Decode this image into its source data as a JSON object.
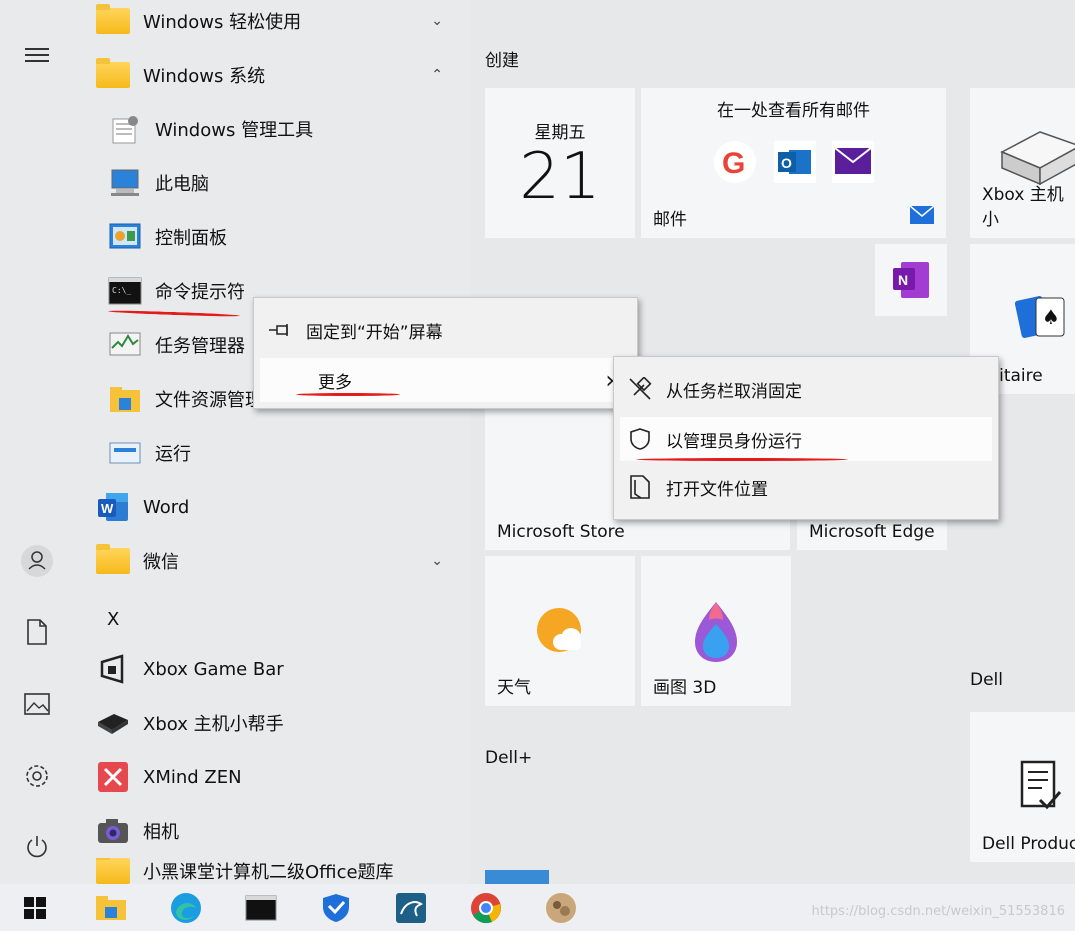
{
  "rail_icons": [
    "menu-icon",
    "user-icon",
    "document-icon",
    "pictures-icon",
    "settings-icon",
    "power-icon"
  ],
  "app_list": {
    "items": [
      {
        "label": "Windows 轻松使用",
        "icon": "folder-icon",
        "chevron": "⌄"
      },
      {
        "label": "Windows 系统",
        "icon": "folder-icon",
        "chevron": "⌃"
      },
      {
        "label": "Windows 管理工具",
        "icon": "admin-tools-icon"
      },
      {
        "label": "此电脑",
        "icon": "this-pc-icon"
      },
      {
        "label": "控制面板",
        "icon": "control-panel-icon"
      },
      {
        "label": "命令提示符",
        "icon": "cmd-icon"
      },
      {
        "label": "任务管理器",
        "icon": "task-manager-icon"
      },
      {
        "label": "文件资源管理器",
        "icon": "file-explorer-icon"
      },
      {
        "label": "运行",
        "icon": "run-icon"
      },
      {
        "label": "Word",
        "icon": "word-icon"
      },
      {
        "label": "微信",
        "icon": "folder-icon",
        "chevron": "⌄"
      },
      {
        "label": "X",
        "icon": "section-letter"
      },
      {
        "label": "Xbox Game Bar",
        "icon": "xbox-game-bar-icon"
      },
      {
        "label": "Xbox 主机小帮手",
        "icon": "xbox-console-icon"
      },
      {
        "label": "XMind ZEN",
        "icon": "xmind-icon"
      },
      {
        "label": "相机",
        "icon": "camera-icon"
      },
      {
        "label": "小黑课堂计算机二级Office题库",
        "icon": "folder-icon"
      }
    ]
  },
  "tiles": {
    "group_create": "创建",
    "calendar": {
      "day": "星期五",
      "date": "21"
    },
    "mail": {
      "title": "在一处查看所有邮件",
      "label": "邮件"
    },
    "xbox": {
      "label": "Xbox 主机小"
    },
    "solitaire": {
      "label": "olitaire"
    },
    "store": {
      "label": "Microsoft Store"
    },
    "edge": {
      "label": "Microsoft Edge"
    },
    "weather": {
      "label": "天气"
    },
    "paint3d": {
      "label": "画图 3D"
    },
    "group_dell": "Dell",
    "group_dellplus": "Dell+",
    "dell_product": {
      "label": "Dell Produc"
    }
  },
  "context_menu": {
    "items": [
      {
        "label": "固定到“开始”屏幕",
        "icon": "pin-icon"
      },
      {
        "label": "更多",
        "icon": "",
        "arrow": "›"
      }
    ]
  },
  "sub_menu": {
    "items": [
      {
        "label": "从任务栏取消固定",
        "icon": "unpin-icon"
      },
      {
        "label": "以管理员身份运行",
        "icon": "shield-icon"
      },
      {
        "label": "打开文件位置",
        "icon": "file-location-icon"
      }
    ]
  },
  "taskbar": [
    "windows-start-icon",
    "file-explorer-icon",
    "edge-icon",
    "cmd-icon",
    "security-shield-icon",
    "mysql-icon",
    "chrome-icon",
    "avatar-icon"
  ],
  "watermark": "https://blog.csdn.net/weixin_51553816",
  "colors": {
    "annotation_red": "#e31b1b",
    "accent_blue": "#1e6fd9"
  }
}
